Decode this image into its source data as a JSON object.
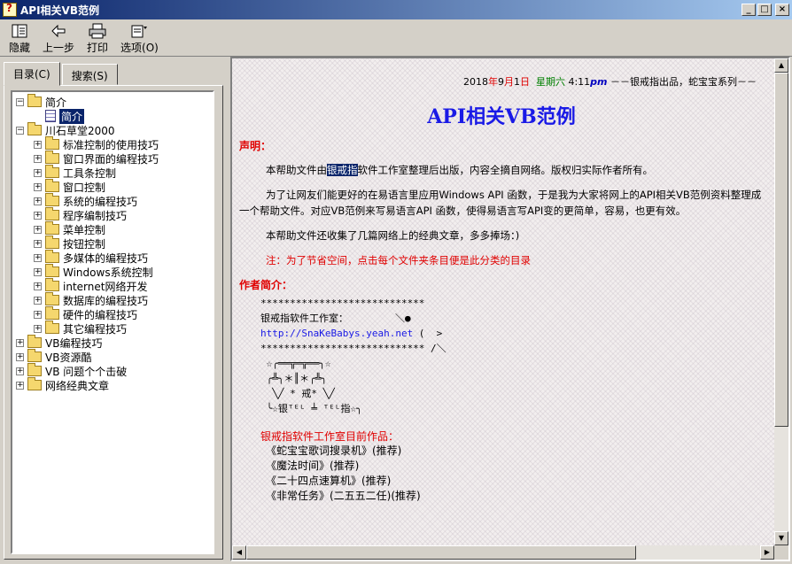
{
  "window": {
    "title": "API相关VB范例",
    "buttons": {
      "minimize": "_",
      "maximize": "□",
      "close": "×"
    }
  },
  "toolbar": {
    "items": [
      {
        "label": "隐藏",
        "icon": "hide-pane-icon"
      },
      {
        "label": "上一步",
        "icon": "back-arrow-icon"
      },
      {
        "label": "打印",
        "icon": "printer-icon"
      },
      {
        "label": "选项(O)",
        "icon": "options-icon"
      }
    ]
  },
  "tabs": [
    {
      "label": "目录(C)",
      "active": true
    },
    {
      "label": "搜索(S)",
      "active": false
    }
  ],
  "tree": [
    {
      "level": 0,
      "expander": "⊟",
      "icon": "folder",
      "label": "简介"
    },
    {
      "level": 1,
      "expander": "",
      "icon": "doc",
      "label": "简介",
      "selected": true
    },
    {
      "level": 0,
      "expander": "⊟",
      "icon": "folder",
      "label": "川石草堂2000"
    },
    {
      "level": 1,
      "expander": "+",
      "icon": "folder",
      "label": "标准控制的使用技巧"
    },
    {
      "level": 1,
      "expander": "+",
      "icon": "folder",
      "label": "窗口界面的编程技巧"
    },
    {
      "level": 1,
      "expander": "+",
      "icon": "folder",
      "label": "工具条控制"
    },
    {
      "level": 1,
      "expander": "+",
      "icon": "folder",
      "label": "窗口控制"
    },
    {
      "level": 1,
      "expander": "+",
      "icon": "folder",
      "label": "系统的编程技巧"
    },
    {
      "level": 1,
      "expander": "+",
      "icon": "folder",
      "label": "程序编制技巧"
    },
    {
      "level": 1,
      "expander": "+",
      "icon": "folder",
      "label": "菜单控制"
    },
    {
      "level": 1,
      "expander": "+",
      "icon": "folder",
      "label": "按钮控制"
    },
    {
      "level": 1,
      "expander": "+",
      "icon": "folder",
      "label": "多媒体的编程技巧"
    },
    {
      "level": 1,
      "expander": "+",
      "icon": "folder",
      "label": "Windows系统控制"
    },
    {
      "level": 1,
      "expander": "+",
      "icon": "folder",
      "label": "internet网络开发"
    },
    {
      "level": 1,
      "expander": "+",
      "icon": "folder",
      "label": "数据库的编程技巧"
    },
    {
      "level": 1,
      "expander": "+",
      "icon": "folder",
      "label": "硬件的编程技巧"
    },
    {
      "level": 1,
      "expander": "+",
      "icon": "folder",
      "label": "其它编程技巧"
    },
    {
      "level": 0,
      "expander": "+",
      "icon": "folder",
      "label": "VB编程技巧"
    },
    {
      "level": 0,
      "expander": "+",
      "icon": "folder",
      "label": "VB资源酷"
    },
    {
      "level": 0,
      "expander": "+",
      "icon": "folder",
      "label": "VB 问题个个击破"
    },
    {
      "level": 0,
      "expander": "+",
      "icon": "folder",
      "label": "网络经典文章"
    }
  ],
  "content": {
    "date": {
      "year": "2018",
      "y": "年",
      "month": "9",
      "m": "月",
      "day": "1",
      "d": "日",
      "weekday": "星期六",
      "time": "4:11",
      "ampm": "pm",
      "tail": "－－银戒指出品，蛇宝宝系列－－"
    },
    "title": "API相关VB范例",
    "statement_heading": "声明：",
    "para1_before": "本帮助文件由",
    "para1_highlight": "银戒指",
    "para1_after": "软件工作室整理后出版，内容全摘自网络。版权归实际作者所有。",
    "para2": "为了让网友们能更好的在易语言里应用Windows API 函数，于是我为大家将网上的API相关VB范例资料整理成一个帮助文件。对应VB范例来写易语言API 函数，使得易语言写API变的更简单，容易，也更有效。",
    "para3": "本帮助文件还收集了几篇网络上的经典文章，多多捧场：)",
    "note": "注：为了节省空间，点击每个文件夹条目便是此分类的目录",
    "author_heading": "作者简介：",
    "ascii": {
      "line1": "****************************",
      "line2": "银戒指软件工作室：        ＼●",
      "link": "http://SnaKeBabys.yeah.net",
      "line3_tail": " (  >",
      "line4": "**************************** /＼",
      "line5": " ☆╭══╦═╦══╮☆",
      "line6": " ╭╩╮＊║＊╭╩╮",
      "line7": "  ╲╱ * 戒* ╲╱",
      "line8": " ╰☆银ᵀᴱᴸ ╧ ᵀᴱᴸ指☆╮"
    },
    "products_heading": "银戒指软件工作室目前作品：",
    "products": [
      "《蛇宝宝歌词搜录机》(推荐)",
      "《魔法时间》(推荐)",
      "《二十四点速算机》(推荐)",
      "《非常任务》(二五五二任)(推荐)"
    ]
  }
}
